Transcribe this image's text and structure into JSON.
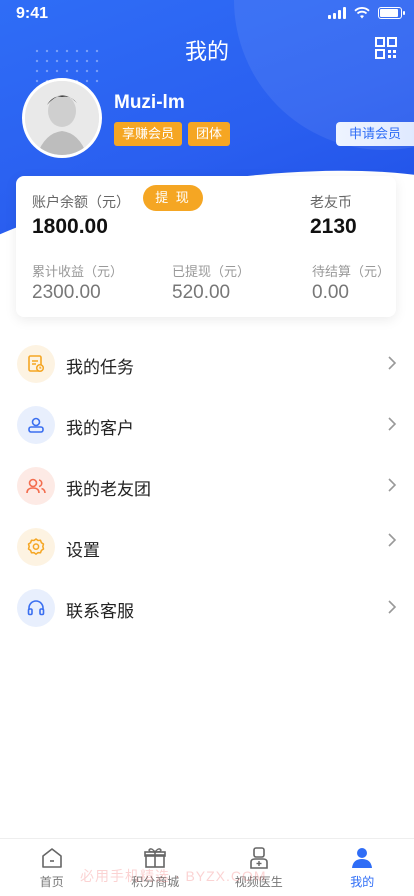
{
  "status_bar": {
    "time": "9:41"
  },
  "header": {
    "title": "我的",
    "scan_icon": "qr-scan-icon"
  },
  "profile": {
    "username": "Muzi-lm",
    "badges": [
      "享赚会员",
      "团体"
    ],
    "apply_label": "申请会员"
  },
  "wallet": {
    "balance_label": "账户余额（元）",
    "balance_value": "1800.00",
    "withdraw_label": "提 现",
    "coin_label": "老友币",
    "coin_value": "2130",
    "stats": [
      {
        "label": "累计收益（元）",
        "value": "2300.00"
      },
      {
        "label": "已提现（元）",
        "value": "520.00"
      },
      {
        "label": "待结算（元）",
        "value": "0.00"
      }
    ]
  },
  "menu": [
    {
      "label": "我的任务",
      "icon": "task-icon",
      "color": "#f5a623",
      "bg": "#fdf3e2"
    },
    {
      "label": "我的客户",
      "icon": "customer-icon",
      "color": "#3a6ff0",
      "bg": "#e8effd"
    },
    {
      "label": "我的老友团",
      "icon": "group-icon",
      "color": "#f36d4e",
      "bg": "#fdeae5"
    },
    {
      "label": "设置",
      "icon": "settings-icon",
      "color": "#f5a623",
      "bg": "#fdf3e2"
    },
    {
      "label": "联系客服",
      "icon": "headset-icon",
      "color": "#3a6ff0",
      "bg": "#e8effd"
    }
  ],
  "tabbar": [
    {
      "label": "首页",
      "icon": "home-icon",
      "active": false
    },
    {
      "label": "积分商城",
      "icon": "gift-icon",
      "active": false
    },
    {
      "label": "视频医生",
      "icon": "doctor-icon",
      "active": false
    },
    {
      "label": "我的",
      "icon": "profile-icon",
      "active": true
    }
  ],
  "watermark": "必用手机精选 · BYZX.COM"
}
